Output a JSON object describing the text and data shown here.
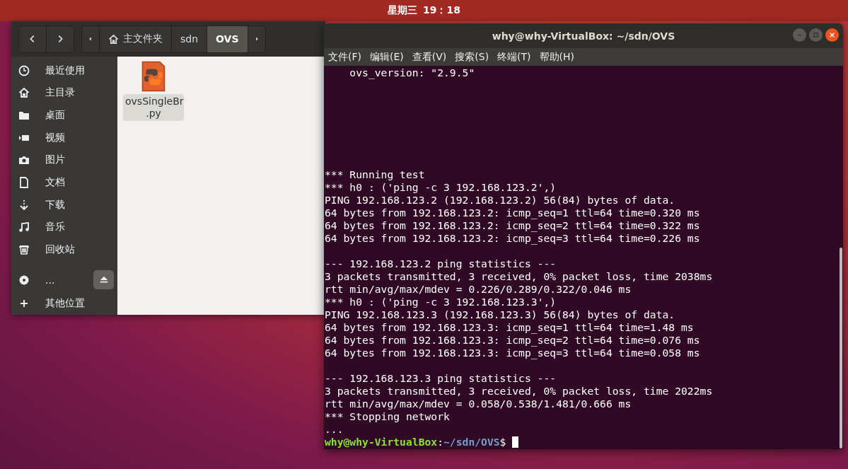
{
  "top_bar": {
    "day": "星期三",
    "time": "19：18"
  },
  "file_manager": {
    "nav": [
      {
        "kind": "back"
      },
      {
        "kind": "forward"
      }
    ],
    "path": [
      {
        "label": "主文件夹",
        "kind": "home",
        "selected": false
      },
      {
        "label": "sdn",
        "kind": "folder",
        "selected": false
      },
      {
        "label": "OVS",
        "kind": "folder",
        "selected": true
      }
    ],
    "sidebar": [
      {
        "label": "最近使用",
        "kind": "clock",
        "selected": false
      },
      {
        "label": "主目录",
        "kind": "home",
        "selected": false
      },
      {
        "label": "桌面",
        "kind": "folder",
        "selected": false
      },
      {
        "label": "视频",
        "kind": "video",
        "selected": false
      },
      {
        "label": "图片",
        "kind": "camera",
        "selected": false
      },
      {
        "label": "文档",
        "kind": "document",
        "selected": false
      },
      {
        "label": "下载",
        "kind": "download",
        "selected": false
      },
      {
        "label": "音乐",
        "kind": "music",
        "selected": false
      },
      {
        "label": "回收站",
        "kind": "trash",
        "selected": false
      },
      {
        "label": "...",
        "kind": "disc",
        "selected": false,
        "ejectable": true
      },
      {
        "label": "其他位置",
        "kind": "plus",
        "selected": false
      }
    ],
    "files": [
      {
        "name": "ovsSingleBr\n.py",
        "selected": true
      }
    ]
  },
  "terminal": {
    "title": "why@why-VirtualBox: ~/sdn/OVS",
    "menu": [
      "文件(F)",
      "编辑(E)",
      "查看(V)",
      "搜索(S)",
      "终端(T)",
      "帮助(H)"
    ],
    "lines": [
      {
        "kind": "text",
        "text": "    ovs_version: \"2.9.5\""
      },
      {
        "kind": "blank"
      },
      {
        "kind": "blank"
      },
      {
        "kind": "blank"
      },
      {
        "kind": "blank"
      },
      {
        "kind": "blank"
      },
      {
        "kind": "blank"
      },
      {
        "kind": "blank"
      },
      {
        "kind": "text",
        "text": "*** Running test"
      },
      {
        "kind": "text",
        "text": "*** h0 : ('ping -c 3 192.168.123.2',)"
      },
      {
        "kind": "text",
        "text": "PING 192.168.123.2 (192.168.123.2) 56(84) bytes of data."
      },
      {
        "kind": "text",
        "text": "64 bytes from 192.168.123.2: icmp_seq=1 ttl=64 time=0.320 ms"
      },
      {
        "kind": "text",
        "text": "64 bytes from 192.168.123.2: icmp_seq=2 ttl=64 time=0.322 ms"
      },
      {
        "kind": "text",
        "text": "64 bytes from 192.168.123.2: icmp_seq=3 ttl=64 time=0.226 ms"
      },
      {
        "kind": "blank"
      },
      {
        "kind": "text",
        "text": "--- 192.168.123.2 ping statistics ---"
      },
      {
        "kind": "text",
        "text": "3 packets transmitted, 3 received, 0% packet loss, time 2038ms"
      },
      {
        "kind": "text",
        "text": "rtt min/avg/max/mdev = 0.226/0.289/0.322/0.046 ms"
      },
      {
        "kind": "text",
        "text": "*** h0 : ('ping -c 3 192.168.123.3',)"
      },
      {
        "kind": "text",
        "text": "PING 192.168.123.3 (192.168.123.3) 56(84) bytes of data."
      },
      {
        "kind": "text",
        "text": "64 bytes from 192.168.123.3: icmp_seq=1 ttl=64 time=1.48 ms"
      },
      {
        "kind": "text",
        "text": "64 bytes from 192.168.123.3: icmp_seq=2 ttl=64 time=0.076 ms"
      },
      {
        "kind": "text",
        "text": "64 bytes from 192.168.123.3: icmp_seq=3 ttl=64 time=0.058 ms"
      },
      {
        "kind": "blank"
      },
      {
        "kind": "text",
        "text": "--- 192.168.123.3 ping statistics ---"
      },
      {
        "kind": "text",
        "text": "3 packets transmitted, 3 received, 0% packet loss, time 2022ms"
      },
      {
        "kind": "text",
        "text": "rtt min/avg/max/mdev = 0.058/0.538/1.481/0.666 ms"
      },
      {
        "kind": "text",
        "text": "*** Stopping network"
      },
      {
        "kind": "text",
        "text": "..."
      },
      {
        "kind": "prompt",
        "user_host": "why@why-VirtualBox",
        "separator": ":",
        "path": "~/sdn/OVS",
        "symbol": "$",
        "cursor": true
      }
    ]
  }
}
